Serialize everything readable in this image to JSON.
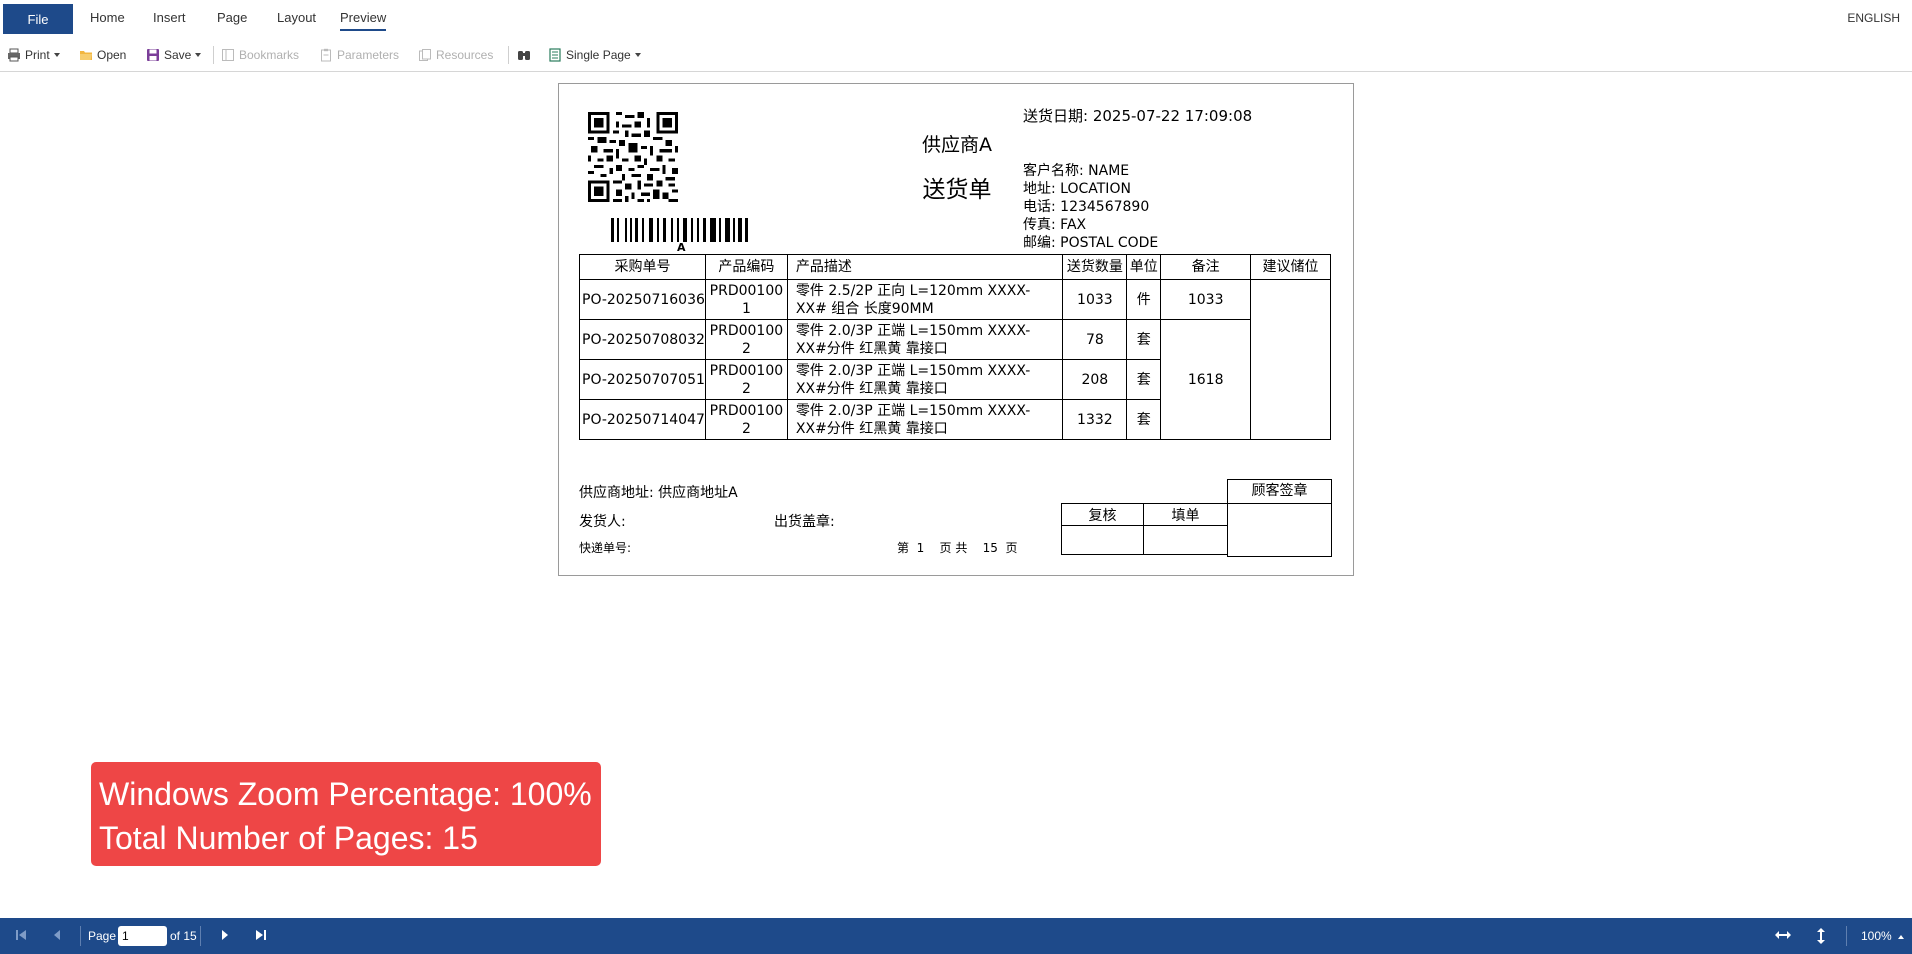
{
  "menu": {
    "file": "File",
    "home": "Home",
    "insert": "Insert",
    "page": "Page",
    "layout": "Layout",
    "preview": "Preview",
    "language": "ENGLISH"
  },
  "toolbar": {
    "print": "Print",
    "open": "Open",
    "save": "Save",
    "bookmarks": "Bookmarks",
    "parameters": "Parameters",
    "resources": "Resources",
    "view_mode": "Single Page"
  },
  "report": {
    "barcode_text": "A",
    "supplier": "供应商A",
    "title": "送货单",
    "date_label": "送货日期:",
    "date_value": "2025-07-22 17:09:08",
    "customer_label": "客户名称:",
    "customer_value": "NAME",
    "address_label": "地址:",
    "address_value": "LOCATION",
    "phone_label": "电话:",
    "phone_value": "1234567890",
    "fax_label": "传真:",
    "fax_value": "FAX",
    "postal_label": "邮编:",
    "postal_value": "POSTAL CODE",
    "columns": [
      "采购单号",
      "产品编码",
      "产品描述",
      "送货数量",
      "单位",
      "备注",
      "建议储位"
    ],
    "rows": [
      {
        "po": "PO-20250716036",
        "code": "PRD00100\n1",
        "desc": "零件 2.5/2P 正向 L=120mm XXXX-\nXX#  组合 长度90MM",
        "qty": "1033",
        "unit": "件",
        "note": "1033"
      },
      {
        "po": "PO-20250708032",
        "code": "PRD00100\n2",
        "desc": "零件 2.0/3P 正端 L=150mm XXXX-\nXX#分件 红黑黄 靠接口",
        "qty": "78",
        "unit": "套"
      },
      {
        "po": "PO-20250707051",
        "code": "PRD00100\n2",
        "desc": "零件 2.0/3P 正端 L=150mm XXXX-\nXX#分件 红黑黄 靠接口",
        "qty": "208",
        "unit": "套"
      },
      {
        "po": "PO-20250714047",
        "code": "PRD00100\n2",
        "desc": "零件 2.0/3P 正端 L=150mm XXXX-\nXX#分件 红黑黄 靠接口",
        "qty": "1332",
        "unit": "套"
      }
    ],
    "merged_note": "1618",
    "supplier_addr_label": "供应商地址:",
    "supplier_addr_value": "供应商地址A",
    "shipper_label": "发货人:",
    "stamp_label": "出货盖章:",
    "express_label": "快递单号:",
    "page_info": "第  1    页 共    15  页",
    "review_label": "复核",
    "fill_label": "填单",
    "guest_sign_label": "顾客签章"
  },
  "overlay": {
    "line1": "Windows Zoom Percentage: 100%",
    "line2": "Total Number of Pages: 15"
  },
  "nav": {
    "page_label": "Page",
    "page_value": "1",
    "of_label": "of 15",
    "zoom": "100%"
  }
}
